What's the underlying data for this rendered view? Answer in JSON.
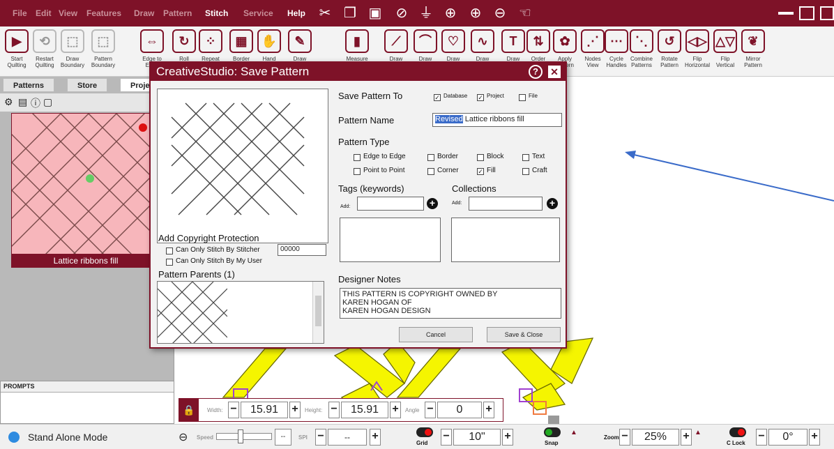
{
  "menu": {
    "items": [
      "File",
      "Edit",
      "View",
      "Features",
      "Draw",
      "Pattern",
      "Stitch",
      "Service",
      "Help"
    ],
    "active": [
      "Stitch",
      "Help"
    ]
  },
  "toolbar": {
    "tools": [
      {
        "label": "Start\nQuilting",
        "icon": "play-icon"
      },
      {
        "label": "Restart\nQuilting",
        "icon": "restart-icon"
      },
      {
        "label": "Draw\nBoundary",
        "icon": "boundary-icon"
      },
      {
        "label": "Pattern\nBoundary",
        "icon": "pattern-boundary-icon"
      },
      {
        "label": "Edge to\nEdge",
        "icon": "edge-icon"
      },
      {
        "label": "Roll",
        "icon": "roll-icon"
      },
      {
        "label": "Repeat",
        "icon": "repeat-icon"
      },
      {
        "label": "Border",
        "icon": "border-icon"
      },
      {
        "label": "Hand",
        "icon": "hand-icon"
      },
      {
        "label": "Draw",
        "icon": "draw-icon"
      },
      {
        "label": "Measure",
        "icon": "measure-icon"
      },
      {
        "label": "Draw",
        "icon": "draw-line-icon"
      },
      {
        "label": "Draw",
        "icon": "draw-arc-icon"
      },
      {
        "label": "Draw",
        "icon": "draw-heart-icon"
      },
      {
        "label": "Draw",
        "icon": "draw-curve-icon"
      },
      {
        "label": "Draw",
        "icon": "text-icon"
      },
      {
        "label": "Order",
        "icon": "order-icon"
      },
      {
        "label": "Apply\nPattern",
        "icon": "apply-pattern-icon"
      },
      {
        "label": "Nodes\nView",
        "icon": "nodes-icon"
      },
      {
        "label": "Cycle\nHandles",
        "icon": "cycle-icon"
      },
      {
        "label": "Combine\nPatterns",
        "icon": "combine-icon"
      },
      {
        "label": "Rotate\nPattern",
        "icon": "rotate-icon"
      },
      {
        "label": "Flip\nHorizontal",
        "icon": "flip-h-icon"
      },
      {
        "label": "Flip\nVertical",
        "icon": "flip-v-icon"
      },
      {
        "label": "Mirror\nPattern",
        "icon": "mirror-icon"
      }
    ]
  },
  "left": {
    "tabs": [
      "Patterns",
      "Store",
      "Proje"
    ],
    "thumb_label": "Lattice ribbons fill",
    "prompts_title": "PROMPTS"
  },
  "dialog": {
    "title": "CreativeStudio: Save Pattern",
    "save_to_label": "Save Pattern To",
    "save_to": [
      {
        "label": "Database",
        "checked": true
      },
      {
        "label": "Project",
        "checked": true
      },
      {
        "label": "File",
        "checked": false
      }
    ],
    "name_label": "Pattern Name",
    "name_selected": "Revised",
    "name_rest": " Lattice ribbons fill",
    "type_label": "Pattern Type",
    "types": [
      {
        "label": "Edge to Edge",
        "checked": false
      },
      {
        "label": "Border",
        "checked": false
      },
      {
        "label": "Block",
        "checked": false
      },
      {
        "label": "Text",
        "checked": false
      },
      {
        "label": "Point to Point",
        "checked": false
      },
      {
        "label": "Corner",
        "checked": false
      },
      {
        "label": "Fill",
        "checked": true
      },
      {
        "label": "Craft",
        "checked": false
      }
    ],
    "tags_label": "Tags (keywords)",
    "collections_label": "Collections",
    "add_label": "Add:",
    "copyright_label": "Add Copyright Protection",
    "cp_stitcher": "Can Only Stitch By Stitcher",
    "cp_stitcher_value": "00000",
    "cp_user": "Can Only Stitch By My User",
    "parents_label": "Pattern Parents (1)",
    "notes_label": "Designer Notes",
    "notes_text": "THIS PATTERN IS COPYRIGHT OWNED BY\nKAREN HOGAN OF\nKAREN HOGAN DESIGN",
    "cancel": "Cancel",
    "save": "Save & Close"
  },
  "sizebar": {
    "width_label": "Width:",
    "width": "15.91",
    "height_label": "Height:",
    "height": "15.91",
    "angle_label": "Angle",
    "angle": "0"
  },
  "status": {
    "mode": "Stand Alone Mode",
    "speed_label": "Speed",
    "speed_value": "--",
    "spi_label": "SPI",
    "spi_value": "--",
    "grid_label": "Grid",
    "grid_value": "10\"",
    "snap_label": "Snap",
    "zoom_label": "Zoom",
    "zoom_value": "25%",
    "clock_label": "C Lock",
    "clock_value": "0°"
  },
  "colors": {
    "brand": "#7e1228",
    "thumb_bg": "#f7b6bb",
    "arrow": "#3a6bc9",
    "lattice_yellow": "#f5f500"
  }
}
